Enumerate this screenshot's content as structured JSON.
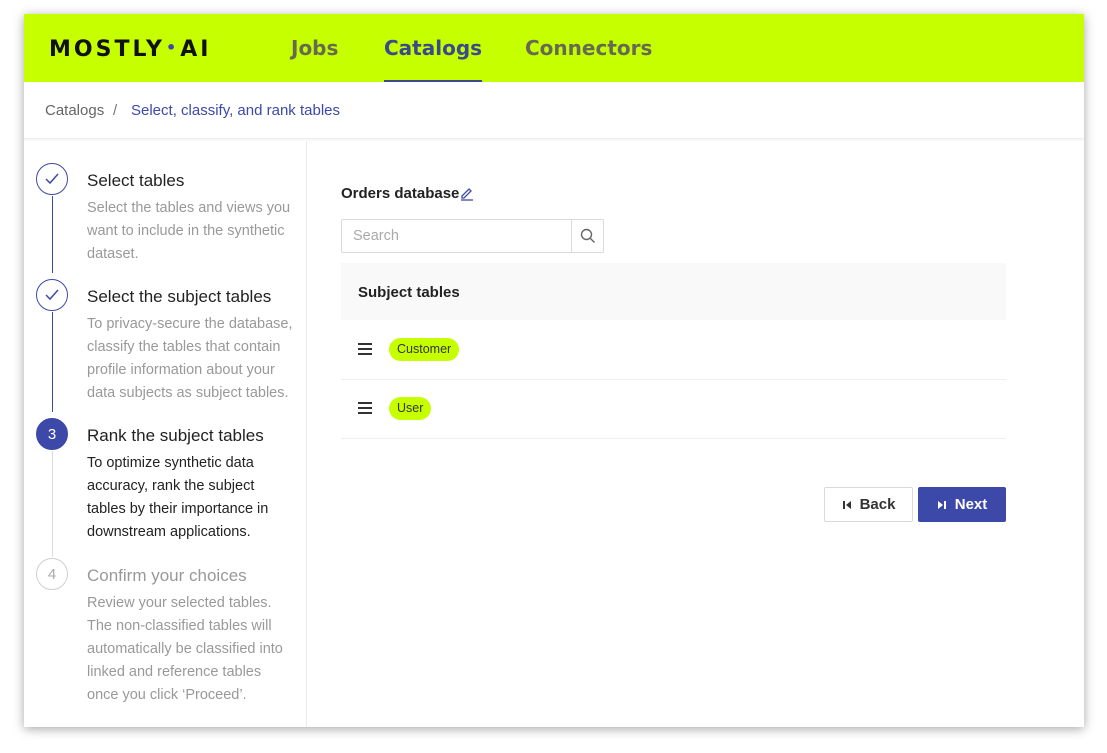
{
  "brand": {
    "logo_left": "MOSTLY",
    "logo_dot": "•",
    "logo_right": "AI"
  },
  "nav": {
    "tabs": [
      {
        "label": "Jobs",
        "active": false
      },
      {
        "label": "Catalogs",
        "active": true
      },
      {
        "label": "Connectors",
        "active": false
      }
    ]
  },
  "breadcrumb": {
    "root": "Catalogs",
    "separator": "/",
    "current": "Select, classify, and rank tables"
  },
  "steps": [
    {
      "marker": "✓",
      "status": "done",
      "title": "Select tables",
      "desc_lines": [
        "Select the tables and views you",
        "want to include in the synthetic",
        "dataset."
      ]
    },
    {
      "marker": "✓",
      "status": "done",
      "title": "Select the subject tables",
      "desc_lines": [
        "To privacy-secure the database,",
        "classify the tables that contain",
        "profile information about your",
        "data subjects as subject tables."
      ]
    },
    {
      "marker": "3",
      "status": "active",
      "title": "Rank the subject tables",
      "desc_lines": [
        "To optimize synthetic data",
        "accuracy, rank the subject",
        "tables by their importance in",
        "downstream applications."
      ]
    },
    {
      "marker": "4",
      "status": "pending",
      "title": "Confirm your choices",
      "desc_lines": [
        "Review your selected tables.",
        "The non-classified tables will",
        "automatically be classified into",
        "linked and reference tables",
        "once you click ‘Proceed’."
      ]
    }
  ],
  "main": {
    "database_title": "Orders database",
    "search": {
      "placeholder": "Search",
      "value": ""
    },
    "table_header": "Subject tables",
    "subject_tables": [
      "Customer",
      "User"
    ],
    "back_label": "Back",
    "next_label": "Next"
  },
  "icons": {
    "check": "check-icon",
    "edit": "pencil-icon",
    "search": "search-icon",
    "drag": "drag-handle-icon",
    "back": "skip-back-icon",
    "next": "skip-next-icon"
  },
  "colors": {
    "accent": "#c6ff00",
    "primary": "#3d49a8"
  }
}
